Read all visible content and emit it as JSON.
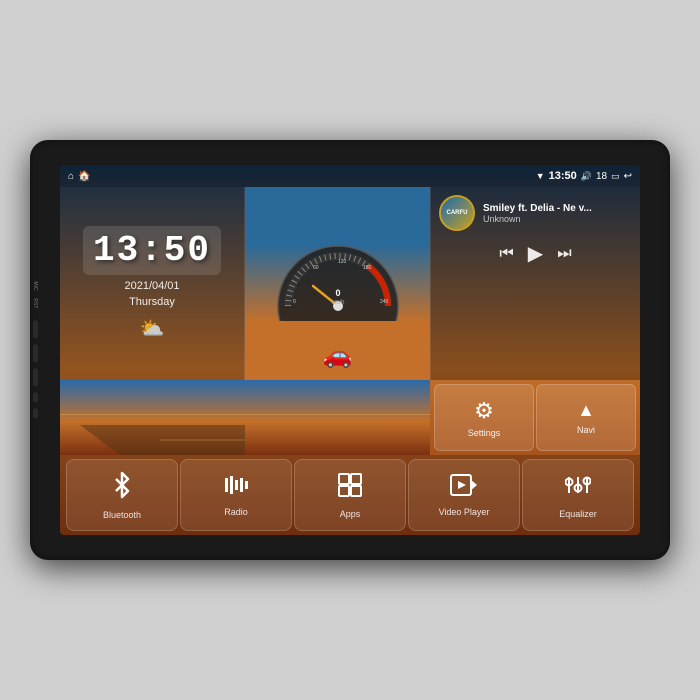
{
  "device": {
    "side_labels": [
      "MIC",
      "RST"
    ]
  },
  "status_bar": {
    "home_icon": "⌂",
    "home2_icon": "🏠",
    "wifi_icon": "▼",
    "time": "13:50",
    "volume_icon": "🔊",
    "volume_level": "18",
    "battery_icon": "▭",
    "back_icon": "↩"
  },
  "clock": {
    "time": "13:50",
    "date": "2021/04/01",
    "day": "Thursday",
    "weather_icon": "⛅"
  },
  "music": {
    "logo": "CARFU",
    "title": "Smiley ft. Delia - Ne v...",
    "artist": "Unknown",
    "prev_icon": "⏮",
    "play_icon": "▶",
    "next_icon": "⏭"
  },
  "speedo": {
    "speed": "0",
    "unit": "km/h"
  },
  "settings_btn": {
    "icon": "⚙",
    "label": "Settings"
  },
  "navi_btn": {
    "icon": "✦",
    "label": "Navi"
  },
  "apps": [
    {
      "id": "bluetooth",
      "icon": "⊛",
      "label": "Bluetooth"
    },
    {
      "id": "radio",
      "icon": "📶",
      "label": "Radio"
    },
    {
      "id": "apps",
      "icon": "⊞",
      "label": "Apps"
    },
    {
      "id": "video",
      "icon": "🎬",
      "label": "Video Player"
    },
    {
      "id": "equalizer",
      "icon": "⊟",
      "label": "Equalizer"
    }
  ]
}
